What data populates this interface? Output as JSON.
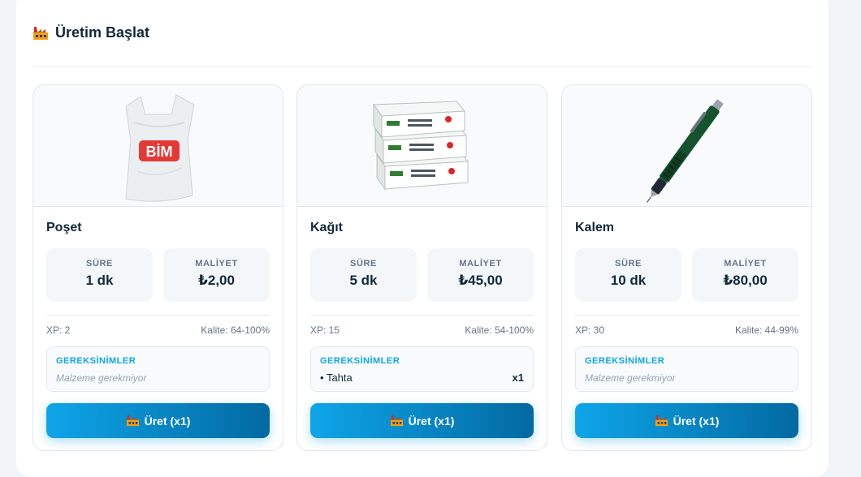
{
  "header": {
    "title": "Üretim Başlat",
    "icon": "factory-icon"
  },
  "stat_labels": {
    "duration": "SÜRE",
    "cost": "MALİYET"
  },
  "requirements_title": "GEREKSİNİMLER",
  "products": [
    {
      "name": "Poşet",
      "image": "plastic-bag-image",
      "image_text": "BİM",
      "duration": "1 dk",
      "cost": "₺2,00",
      "xp": "XP: 2",
      "quality": "Kalite: 64-100%",
      "requirements_empty": "Malzeme gerekmiyor",
      "button": "Üret (x1)"
    },
    {
      "name": "Kağıt",
      "image": "paper-packs-image",
      "duration": "5 dk",
      "cost": "₺45,00",
      "xp": "XP: 15",
      "quality": "Kalite: 54-100%",
      "requirements": [
        {
          "name": "Tahta",
          "qty": "x1"
        }
      ],
      "button": "Üret (x1)"
    },
    {
      "name": "Kalem",
      "image": "mechanical-pencil-image",
      "duration": "10 dk",
      "cost": "₺80,00",
      "xp": "XP: 30",
      "quality": "Kalite: 44-99%",
      "requirements_empty": "Malzeme gerekmiyor",
      "button": "Üret (x1)"
    }
  ]
}
